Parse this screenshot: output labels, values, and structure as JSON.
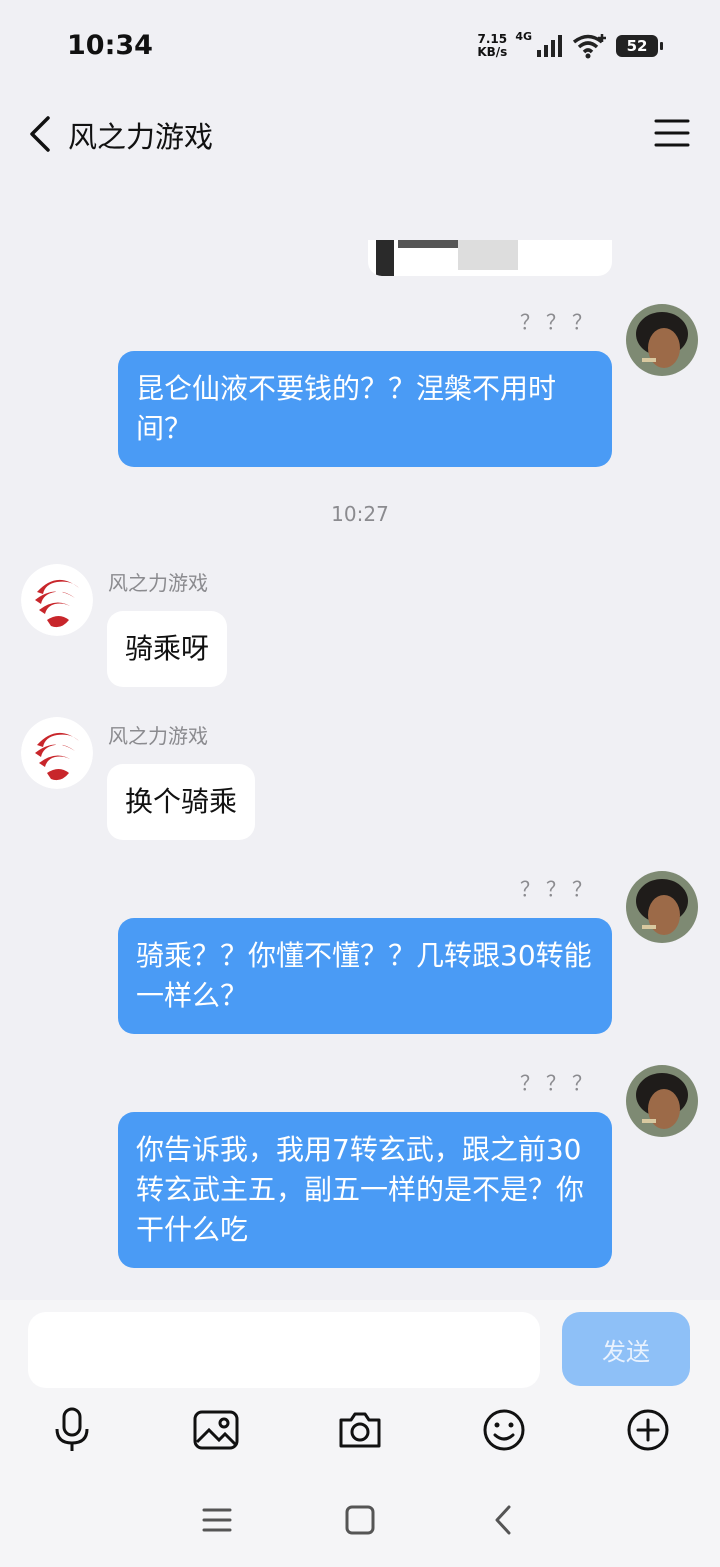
{
  "status_bar": {
    "time": "10:34",
    "speed_value": "7.15",
    "speed_unit": "KB/s",
    "network": "4G",
    "battery": "52"
  },
  "header": {
    "title": "风之力游戏",
    "back_icon": "chevron-left-icon",
    "menu_icon": "hamburger-menu-icon"
  },
  "messages": [
    {
      "side": "out",
      "sender": "？？？",
      "text": "昆仑仙液不要钱的？？涅槃不用时间？"
    },
    {
      "timestamp": "10:27"
    },
    {
      "side": "in",
      "sender": "风之力游戏",
      "text": "骑乘呀"
    },
    {
      "side": "in",
      "sender": "风之力游戏",
      "text": "换个骑乘"
    },
    {
      "side": "out",
      "sender": "？？？",
      "text": "骑乘？？你懂不懂？？几转跟30转能一样么？"
    },
    {
      "side": "out",
      "sender": "？？？",
      "text": "你告诉我，我用7转玄武，跟之前30转玄武主五，副五一样的是不是？你干什么吃"
    }
  ],
  "input": {
    "value": "",
    "placeholder": "",
    "send_label": "发送"
  },
  "toolbar": [
    "microphone-icon",
    "image-icon",
    "camera-icon",
    "emoji-icon",
    "plus-icon"
  ],
  "navbar": [
    "recent-apps-icon",
    "home-icon",
    "back-icon"
  ],
  "colors": {
    "background": "#f0f0f4",
    "outgoing_bubble": "#4a9bf5",
    "incoming_bubble": "#ffffff",
    "send_button": "#8ec0f7",
    "brand_red": "#c8262b"
  }
}
